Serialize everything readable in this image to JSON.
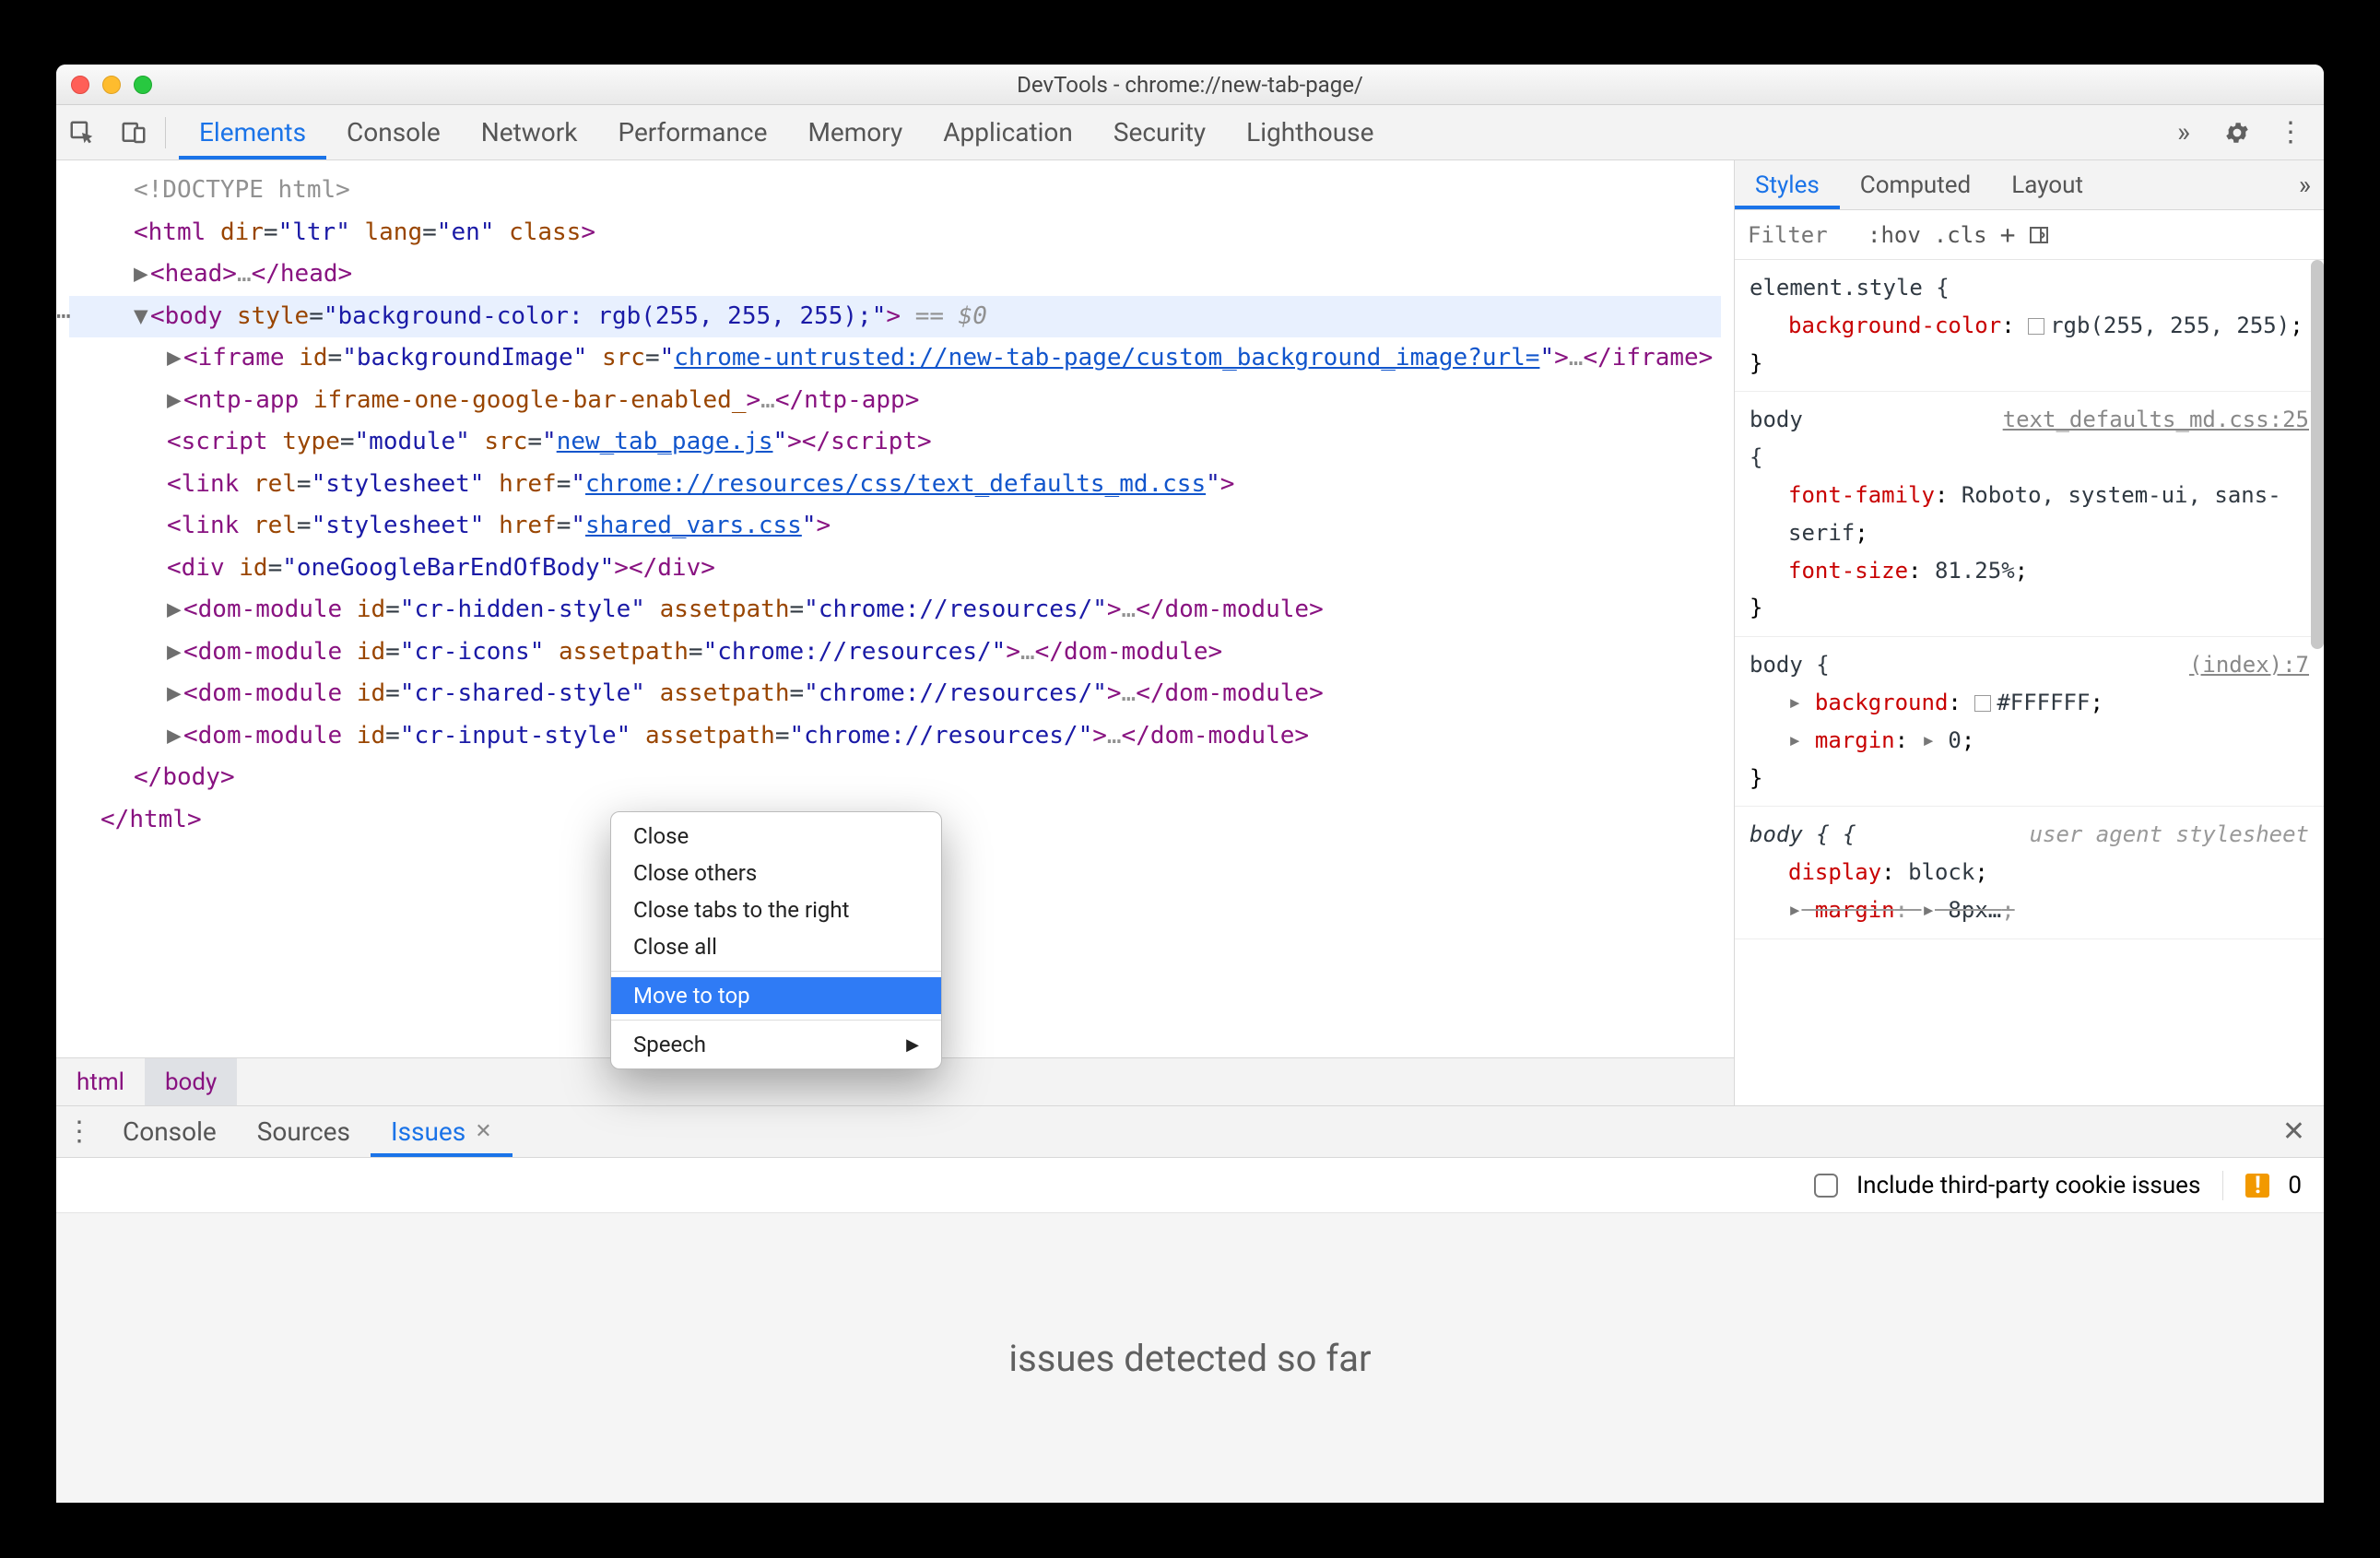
{
  "window": {
    "title": "DevTools - chrome://new-tab-page/"
  },
  "toolbar": {
    "tabs": [
      "Elements",
      "Console",
      "Network",
      "Performance",
      "Memory",
      "Application",
      "Security",
      "Lighthouse"
    ],
    "activeIndex": 0
  },
  "dom_tree": {
    "lines": [
      {
        "id": "doctype",
        "html": "<span class='gray'>&lt;!DOCTYPE html&gt;</span>"
      },
      {
        "id": "html-open",
        "html": "<span class='punc'>&lt;</span><span class='tag'>html</span> <span class='attr-name'>dir</span>=<span class='quote'>\"</span><span class='attr-val'>ltr</span><span class='quote'>\"</span> <span class='attr-name'>lang</span>=<span class='quote'>\"</span><span class='attr-val'>en</span><span class='quote'>\"</span> <span class='attr-name'>class</span><span class='punc'>&gt;</span>"
      },
      {
        "id": "head",
        "arrow": "▶",
        "html": "<span class='punc'>&lt;</span><span class='tag'>head</span><span class='punc'>&gt;</span><span class='gray'>…</span><span class='punc'>&lt;/</span><span class='tag'>head</span><span class='punc'>&gt;</span>"
      },
      {
        "id": "body-open",
        "selected": true,
        "arrow": "▼",
        "html": "<span class='punc'>&lt;</span><span class='tag'>body</span> <span class='attr-name'>style</span>=<span class='quote'>\"</span><span class='attr-val'>background-color: rgb(255, 255, 255);</span><span class='quote'>\"</span><span class='punc'>&gt;</span> <span class='eq0'>== $0</span>"
      },
      {
        "id": "iframe",
        "arrow": "▶",
        "indent": 1,
        "html": "<span class='punc'>&lt;</span><span class='tag'>iframe</span> <span class='attr-name'>id</span>=<span class='quote'>\"</span><span class='attr-val'>backgroundImage</span><span class='quote'>\"</span> <span class='attr-name'>src</span>=<span class='quote'>\"</span><span class='link'>chrome-untrusted://new-tab-page/custom_background_image?url=</span><span class='quote'>\"</span><span class='punc'>&gt;</span><span class='gray'>…</span><span class='punc'>&lt;/</span><span class='tag'>iframe</span><span class='punc'>&gt;</span>"
      },
      {
        "id": "ntp-app",
        "arrow": "▶",
        "indent": 1,
        "html": "<span class='punc'>&lt;</span><span class='tag'>ntp-app</span> <span class='attr-name'>iframe-one-google-bar-enabled_</span><span class='punc'>&gt;</span><span class='gray'>…</span><span class='punc'>&lt;/</span><span class='tag'>ntp-app</span><span class='punc'>&gt;</span>"
      },
      {
        "id": "script",
        "indent": 1,
        "html": "<span class='punc'>&lt;</span><span class='tag'>script</span> <span class='attr-name'>type</span>=<span class='quote'>\"</span><span class='attr-val'>module</span><span class='quote'>\"</span> <span class='attr-name'>src</span>=<span class='quote'>\"</span><span class='link'>new_tab_page.js</span><span class='quote'>\"</span><span class='punc'>&gt;&lt;/</span><span class='tag'>script</span><span class='punc'>&gt;</span>"
      },
      {
        "id": "link1",
        "indent": 1,
        "html": "<span class='punc'>&lt;</span><span class='tag'>link</span> <span class='attr-name'>rel</span>=<span class='quote'>\"</span><span class='attr-val'>stylesheet</span><span class='quote'>\"</span> <span class='attr-name'>href</span>=<span class='quote'>\"</span><span class='link'>chrome://resources/css/text_defaults_md.css</span><span class='quote'>\"</span><span class='punc'>&gt;</span>"
      },
      {
        "id": "link2",
        "indent": 1,
        "html": "<span class='punc'>&lt;</span><span class='tag'>link</span> <span class='attr-name'>rel</span>=<span class='quote'>\"</span><span class='attr-val'>stylesheet</span><span class='quote'>\"</span> <span class='attr-name'>href</span>=<span class='quote'>\"</span><span class='link'>shared_vars.css</span><span class='quote'>\"</span><span class='punc'>&gt;</span>"
      },
      {
        "id": "div",
        "indent": 1,
        "html": "<span class='punc'>&lt;</span><span class='tag'>div</span> <span class='attr-name'>id</span>=<span class='quote'>\"</span><span class='attr-val'>oneGoogleBarEndOfBody</span><span class='quote'>\"</span><span class='punc'>&gt;&lt;/</span><span class='tag'>div</span><span class='punc'>&gt;</span>"
      },
      {
        "id": "dm1",
        "arrow": "▶",
        "indent": 1,
        "html": "<span class='punc'>&lt;</span><span class='tag'>dom-module</span> <span class='attr-name'>id</span>=<span class='quote'>\"</span><span class='attr-val'>cr-hidden-style</span><span class='quote'>\"</span> <span class='attr-name'>assetpath</span>=<span class='quote'>\"</span><span class='attr-val'>chrome://resources/</span><span class='quote'>\"</span><span class='punc'>&gt;</span><span class='gray'>…</span><span class='punc'>&lt;/</span><span class='tag'>dom-module</span><span class='punc'>&gt;</span>"
      },
      {
        "id": "dm2",
        "arrow": "▶",
        "indent": 1,
        "html": "<span class='punc'>&lt;</span><span class='tag'>dom-module</span> <span class='attr-name'>id</span>=<span class='quote'>\"</span><span class='attr-val'>cr-icons</span><span class='quote'>\"</span> <span class='attr-name'>assetpath</span>=<span class='quote'>\"</span><span class='attr-val'>chrome://resources/</span><span class='quote'>\"</span><span class='punc'>&gt;</span><span class='gray'>…</span><span class='punc'>&lt;/</span><span class='tag'>dom-module</span><span class='punc'>&gt;</span>"
      },
      {
        "id": "dm3",
        "arrow": "▶",
        "indent": 1,
        "html": "<span class='punc'>&lt;</span><span class='tag'>dom-module</span> <span class='attr-name'>id</span>=<span class='quote'>\"</span><span class='attr-val'>cr-shared-style</span><span class='quote'>\"</span> <span class='attr-name'>assetpath</span>=<span class='quote'>\"</span><span class='attr-val'>chrome://resources/</span><span class='quote'>\"</span><span class='punc'>&gt;</span><span class='gray'>…</span><span class='punc'>&lt;/</span><span class='tag'>dom-module</span><span class='punc'>&gt;</span>"
      },
      {
        "id": "dm4",
        "arrow": "▶",
        "indent": 1,
        "html": "<span class='punc'>&lt;</span><span class='tag'>dom-module</span> <span class='attr-name'>id</span>=<span class='quote'>\"</span><span class='attr-val'>cr-input-style</span><span class='quote'>\"</span> <span class='attr-name'>assetpath</span>=<span class='quote'>\"</span><span class='attr-val'>chrome://resources/</span><span class='quote'>\"</span><span class='punc'>&gt;</span><span class='gray'>…</span><span class='punc'>&lt;/</span><span class='tag'>dom-module</span><span class='punc'>&gt;</span>"
      },
      {
        "id": "body-close",
        "indent": 0,
        "html": "<span class='punc'>&lt;/</span><span class='tag'>body</span><span class='punc'>&gt;</span>"
      },
      {
        "id": "html-close",
        "indent": -1,
        "html": "<span class='punc'>&lt;/</span><span class='tag'>html</span><span class='punc'>&gt;</span>"
      }
    ]
  },
  "crumbs": [
    "html",
    "body"
  ],
  "side_tabs": {
    "tabs": [
      "Styles",
      "Computed",
      "Layout"
    ],
    "activeIndex": 0
  },
  "filter": {
    "placeholder": "Filter",
    "hov": ":hov",
    "cls": ".cls"
  },
  "rules": [
    {
      "selector": "element.style",
      "brace_open": " {",
      "decls": [
        {
          "prop": "background-color",
          "val": "rgb(255, 255, 255)",
          "swatch": true
        }
      ]
    },
    {
      "selector": "body",
      "source": "text_defaults_md.css:25",
      "multiline_brace": true,
      "decls": [
        {
          "prop": "font-family",
          "val": "Roboto, system-ui, sans-serif"
        },
        {
          "prop": "font-size",
          "val": "81.25%"
        }
      ]
    },
    {
      "selector": "body { ",
      "source": "(index):7",
      "inline_open": true,
      "decls": [
        {
          "prop": "background",
          "val": "#FFFFFF",
          "swatch": true,
          "expand": true
        },
        {
          "prop": "margin",
          "val": "0",
          "expand": true
        }
      ]
    },
    {
      "selector": "body {",
      "ua": "user agent stylesheet",
      "italic": true,
      "decls": [
        {
          "prop": "display",
          "val": "block"
        },
        {
          "prop": "margin",
          "val": "8px",
          "expand": true,
          "strike": true,
          "truncated": true
        }
      ]
    }
  ],
  "drawer": {
    "tabs": [
      {
        "label": "Console"
      },
      {
        "label": "Sources"
      },
      {
        "label": "Issues",
        "closeable": true,
        "active": true
      }
    ],
    "include_label": "Include third-party cookie issues",
    "issues_count": "0",
    "body_text": "issues detected so far"
  },
  "context_menu": {
    "items": [
      {
        "label": "Close"
      },
      {
        "label": "Close others"
      },
      {
        "label": "Close tabs to the right"
      },
      {
        "label": "Close all"
      },
      {
        "sep": true
      },
      {
        "label": "Move to top",
        "highlight": true
      },
      {
        "sep": true
      },
      {
        "label": "Speech",
        "submenu": true
      }
    ]
  }
}
